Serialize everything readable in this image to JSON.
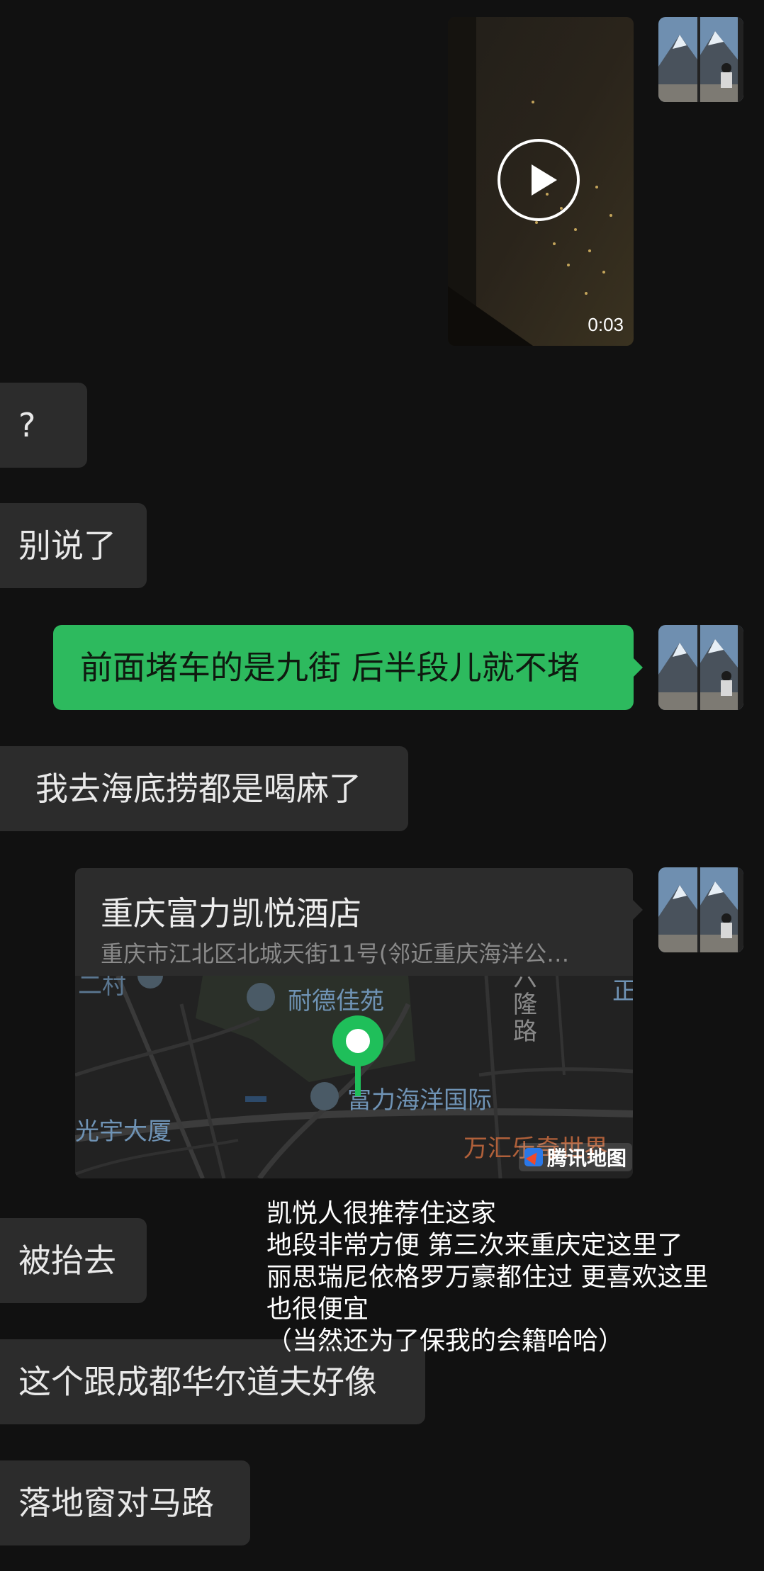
{
  "video": {
    "duration": "0:03"
  },
  "messages": {
    "m1": "?",
    "m2": "别说了",
    "m3": "前面堵车的是九街 后半段儿就不堵",
    "m4": "我去海底捞都是喝麻了",
    "m5": "被抬去",
    "m6": "这个跟成都华尔道夫好像",
    "m7": "落地窗对马路"
  },
  "location": {
    "name": "重庆富力凯悦酒店",
    "address": "重庆市江北区北城天街11号(邻近重庆海洋公…",
    "map_labels": {
      "naide": "耐德佳苑",
      "fuli": "富力海洋国际",
      "guangyu": "光宇大厦",
      "wanhui": "万汇乐奇世界",
      "long_road": "六隆路",
      "cun": "二村",
      "zheng": "正",
      "provider": "腾讯地图"
    }
  },
  "caption": {
    "line1": "凯悦人很推荐住这家",
    "line2": "地段非常方便 第三次来重庆定这里了",
    "line3": "丽思瑞尼依格罗万豪都住过 更喜欢这里",
    "line4": "也很便宜",
    "line5": "（当然还为了保我的会籍哈哈）"
  },
  "colors": {
    "background": "#111111",
    "bubble_in": "#2c2c2c",
    "bubble_out": "#2dba5e"
  }
}
